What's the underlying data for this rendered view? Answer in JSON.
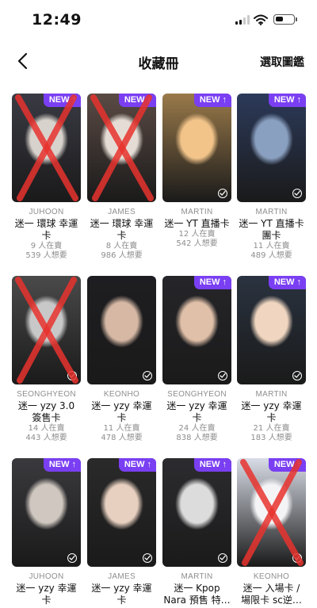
{
  "status": {
    "time": "12:49"
  },
  "header": {
    "title": "收藏冊",
    "action_label": "選取圖鑑",
    "back_icon": "chevron-left-icon"
  },
  "colors": {
    "accent": "#7a3ff2",
    "cross": "#e8332e"
  },
  "cards": [
    {
      "artist": "JUHOON",
      "title": "迷一 環球 幸運\n卡",
      "sellers": "9 人在賣",
      "wanted": "539 人想要",
      "is_new": true,
      "badge": "NEW",
      "crossed": true,
      "owned": false
    },
    {
      "artist": "JAMES",
      "title": "迷一 環球 幸運\n卡",
      "sellers": "8 人在賣",
      "wanted": "986 人想要",
      "is_new": true,
      "badge": "NEW",
      "crossed": true,
      "owned": false
    },
    {
      "artist": "MARTIN",
      "title": "迷一 YT 直播卡",
      "sellers": "12 人在賣",
      "wanted": "542 人想要",
      "is_new": true,
      "badge": "NEW",
      "crossed": false,
      "owned": true
    },
    {
      "artist": "MARTIN",
      "title": "迷一 YT 直播卡\n團卡",
      "sellers": "11 人在賣",
      "wanted": "489 人想要",
      "is_new": true,
      "badge": "NEW",
      "crossed": false,
      "owned": true
    },
    {
      "artist": "SEONGHYEON",
      "title": "迷一 yzy 3.0\n簽售卡",
      "sellers": "14 人在賣",
      "wanted": "443 人想要",
      "is_new": false,
      "badge": "",
      "crossed": true,
      "owned": true
    },
    {
      "artist": "KEONHO",
      "title": "迷一 yzy 幸運\n卡",
      "sellers": "11 人在賣",
      "wanted": "478 人想要",
      "is_new": false,
      "badge": "",
      "crossed": false,
      "owned": true
    },
    {
      "artist": "SEONGHYEON",
      "title": "迷一 yzy 幸運\n卡",
      "sellers": "24 人在賣",
      "wanted": "838 人想要",
      "is_new": true,
      "badge": "NEW",
      "crossed": false,
      "owned": true
    },
    {
      "artist": "MARTIN",
      "title": "迷一 yzy 幸運\n卡",
      "sellers": "21 人在賣",
      "wanted": "183 人想要",
      "is_new": true,
      "badge": "NEW",
      "crossed": false,
      "owned": true
    },
    {
      "artist": "JUHOON",
      "title": "迷一 yzy 幸運\n卡",
      "sellers": "",
      "wanted": "",
      "is_new": true,
      "badge": "NEW",
      "crossed": false,
      "owned": true
    },
    {
      "artist": "JAMES",
      "title": "迷一 yzy 幸運\n卡",
      "sellers": "",
      "wanted": "",
      "is_new": true,
      "badge": "NEW",
      "crossed": false,
      "owned": true
    },
    {
      "artist": "MARTIN",
      "title": "迷一 Kpop\nNara 預售 特…",
      "sellers": "",
      "wanted": "",
      "is_new": true,
      "badge": "NEW",
      "crossed": false,
      "owned": true
    },
    {
      "artist": "KEONHO",
      "title": "迷一 入場卡 /\n場限卡 sc逆…",
      "sellers": "",
      "wanted": "",
      "is_new": true,
      "badge": "NEW",
      "crossed": true,
      "owned": true
    }
  ]
}
